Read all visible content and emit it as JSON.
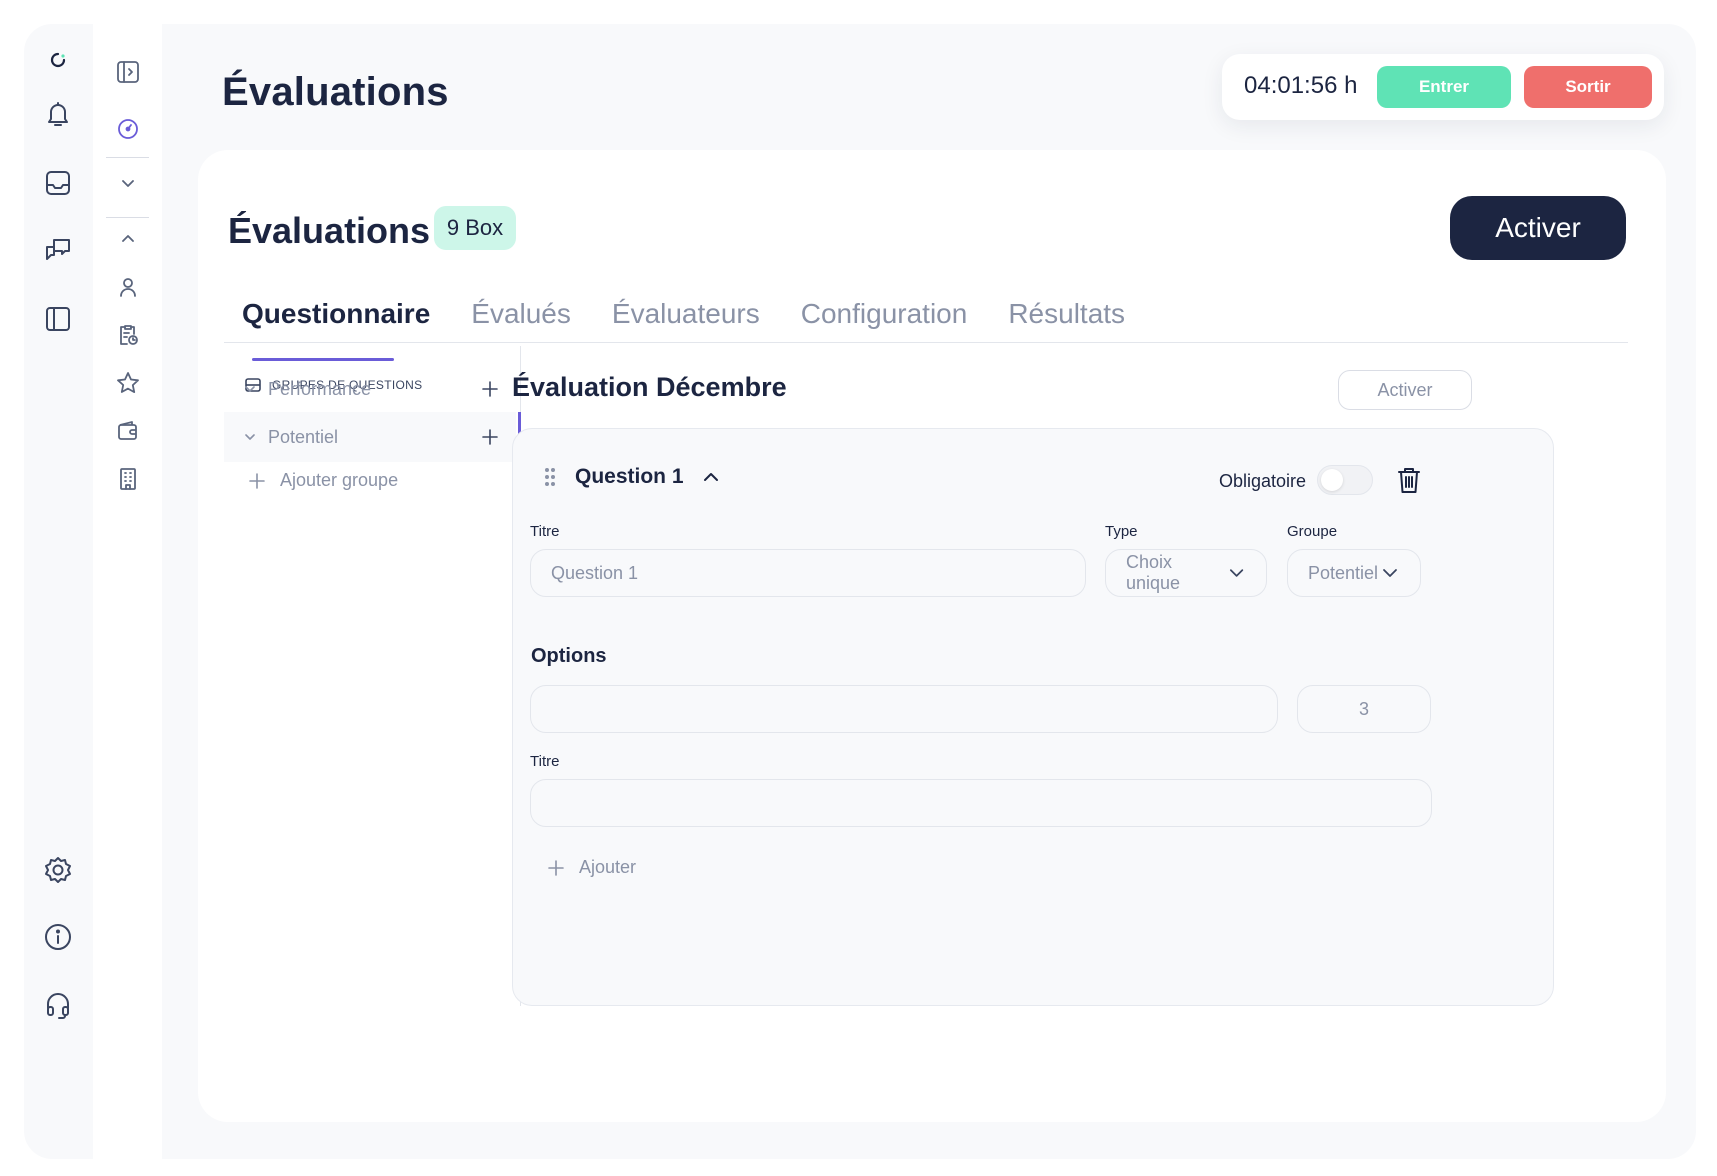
{
  "header": {
    "title": "Évaluations",
    "timer": "04:01:56 h",
    "enter_label": "Entrer",
    "leave_label": "Sortir"
  },
  "card": {
    "title": "Évaluations",
    "badge": "9 Box",
    "activate_label": "Activer",
    "tabs": [
      {
        "label": "Questionnaire",
        "active": true
      },
      {
        "label": "Évalués"
      },
      {
        "label": "Évaluateurs"
      },
      {
        "label": "Configuration"
      },
      {
        "label": "Résultats"
      }
    ]
  },
  "groups": {
    "heading": "GRUPES DE QUESTIONS",
    "items": [
      {
        "label": "Performance"
      },
      {
        "label": "Potentiel",
        "selected": true
      }
    ],
    "add_label": "Ajouter groupe"
  },
  "evaluation": {
    "title": "Évaluation Décembre",
    "activate_label": "Activer",
    "question": {
      "title": "Question 1",
      "mandatory_label": "Obligatoire",
      "mandatory": false,
      "title_label": "Titre",
      "title_value": "Question 1",
      "type_label": "Type",
      "type_value": "Choix unique",
      "group_label": "Groupe",
      "group_value": "Potentiel",
      "options_label": "Options",
      "option_value": "",
      "option_score": "3",
      "option_title_label": "Titre",
      "option_title_value": "",
      "add_label": "Ajouter"
    }
  }
}
